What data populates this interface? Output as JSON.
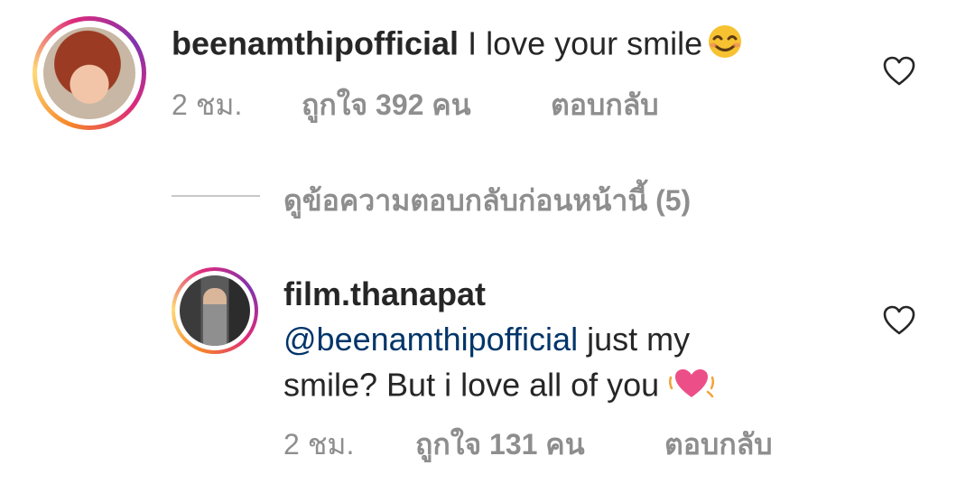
{
  "comments": [
    {
      "username": "beenamthipofficial",
      "text": "I love your smile",
      "emoji": "smiling-face-emoji",
      "time": "2 ชม.",
      "likes": "ถูกใจ 392 คน",
      "reply": "ตอบกลับ"
    },
    {
      "username": "film.thanapat",
      "mention": "@beenamthipofficial",
      "text_line1_rest": " just my",
      "text_line2": "smile? But i love all of you ",
      "emoji": "beating-heart-emoji",
      "time": "2 ชม.",
      "likes": "ถูกใจ 131 คน",
      "reply": "ตอบกลับ"
    }
  ],
  "view_previous_replies": "ดูข้อความตอบกลับก่อนหน้านี้ (5)",
  "colors": {
    "text": "#262626",
    "secondary": "#8e8e8e",
    "mention": "#003569"
  }
}
